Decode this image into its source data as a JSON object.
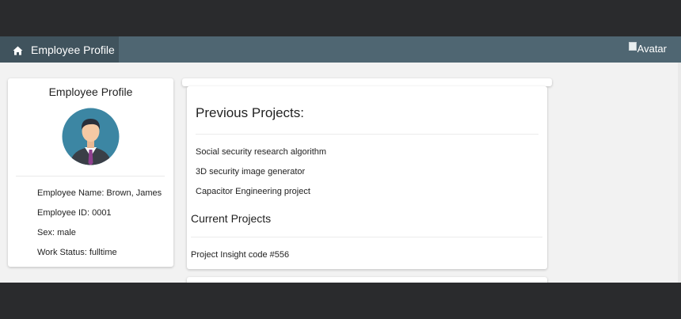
{
  "navbar": {
    "brand_icon": "home-icon",
    "brand_label": "Employee Profile",
    "avatar_alt": "Avatar"
  },
  "profile": {
    "title": "Employee Profile",
    "avatar_icon": "user-avatar-icon",
    "fields": {
      "name": "Employee Name: Brown, James",
      "id": "Employee ID: 0001",
      "sex": "Sex: male",
      "status": "Work Status: fulltime"
    }
  },
  "projects": {
    "previous_heading": "Previous Projects:",
    "previous": [
      "Social security research algorithm",
      "3D security image generator",
      "Capacitor Engineering project"
    ],
    "current_heading": "Current Projects",
    "current": [
      "Project Insight code #556"
    ]
  },
  "colors": {
    "navbar": "#4f6672",
    "navbar_brand": "#40535d",
    "page_background": "#f2f2f2",
    "outer_background": "#2a2b2d",
    "avatar_circle": "#3c86a3",
    "tie": "#8e3f8f"
  }
}
